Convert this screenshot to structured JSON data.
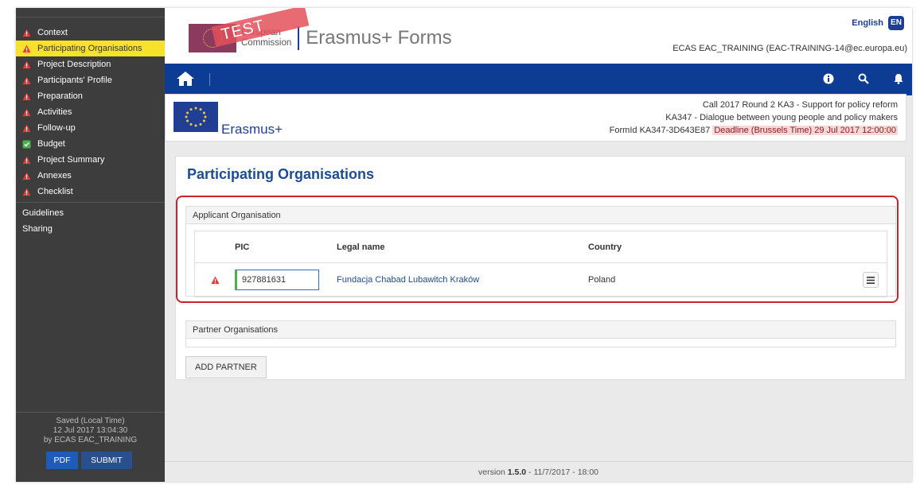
{
  "sidebar": {
    "items": [
      {
        "label": "Context",
        "status": "warning"
      },
      {
        "label": "Participating Organisations",
        "status": "warning"
      },
      {
        "label": "Project Description",
        "status": "warning"
      },
      {
        "label": "Participants' Profile",
        "status": "warning"
      },
      {
        "label": "Preparation",
        "status": "warning"
      },
      {
        "label": "Activities",
        "status": "warning"
      },
      {
        "label": "Follow-up",
        "status": "warning"
      },
      {
        "label": "Budget",
        "status": "ok"
      },
      {
        "label": "Project Summary",
        "status": "warning"
      },
      {
        "label": "Annexes",
        "status": "warning"
      },
      {
        "label": "Checklist",
        "status": "warning"
      }
    ],
    "links": [
      "Guidelines",
      "Sharing"
    ],
    "saved": {
      "line1": "Saved (Local Time)",
      "line2": "12 Jul 2017 13:04:30",
      "line3": "by ECAS EAC_TRAINING"
    },
    "pdf_label": "PDF",
    "submit_label": "SUBMIT"
  },
  "header": {
    "test_banner": "TEST",
    "ec_line1": "European",
    "ec_line2": "Commission",
    "app_title": "Erasmus+ Forms",
    "language": "English",
    "language_code": "EN",
    "user": "ECAS EAC_TRAINING (EAC-TRAINING-14@ec.europa.eu)"
  },
  "programme": {
    "name": "Erasmus+",
    "call": "Call 2017  Round 2  KA3 - Support for policy reform",
    "action": "KA347 - Dialogue between young people and policy makers",
    "form_id": "FormId KA347-3D643E87",
    "deadline": "Deadline (Brussels Time) 29 Jul 2017 12:00:00"
  },
  "main": {
    "title": "Participating Organisations",
    "applicant": {
      "heading": "Applicant Organisation",
      "columns": {
        "pic": "PIC",
        "legal_name": "Legal name",
        "country": "Country"
      },
      "row": {
        "pic": "927881631",
        "legal_name": "Fundacja Chabad Lubawitch Kraków",
        "country": "Poland"
      }
    },
    "partner_heading": "Partner Organisations",
    "add_partner_label": "ADD PARTNER"
  },
  "footer": {
    "prefix": "version ",
    "version": "1.5.0",
    "suffix": " - 11/7/2017 - 18:00"
  },
  "colors": {
    "sidebar_bg": "#3d3d3d",
    "active_item": "#f7e22b",
    "nav_bar": "#0d3c94",
    "warning": "#e53935",
    "ok": "#4caf50",
    "highlight_outline": "#c9242b"
  }
}
